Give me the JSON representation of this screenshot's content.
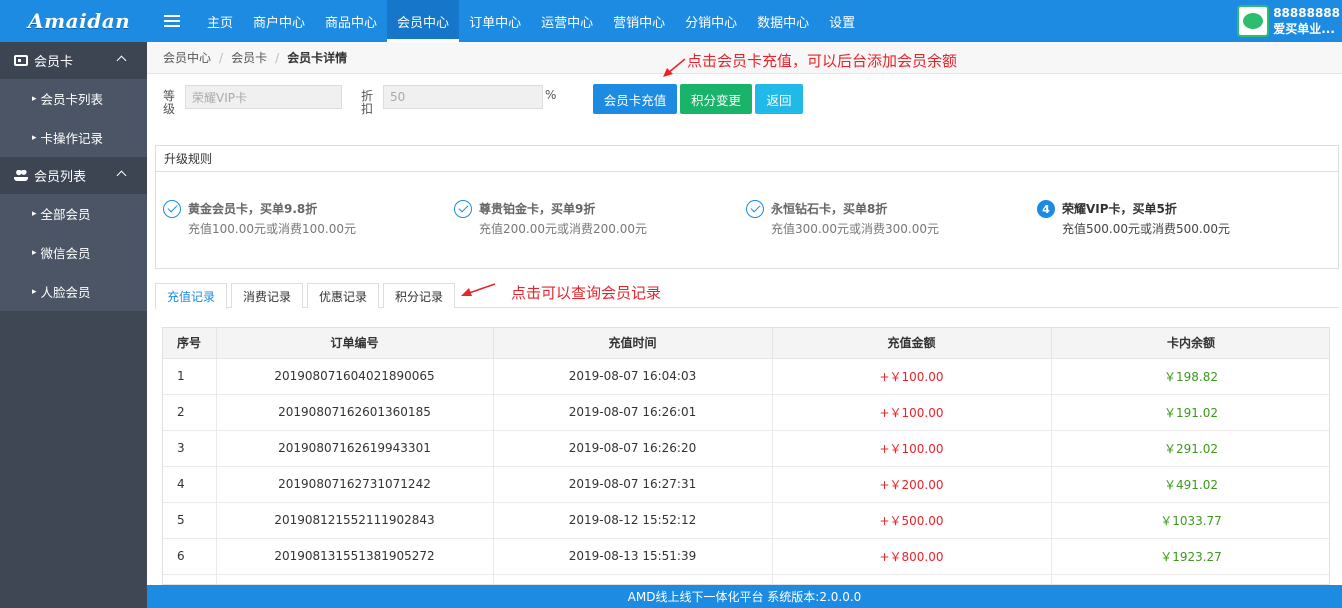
{
  "brand": {
    "logo_text": "Amaidan"
  },
  "nav": {
    "items": [
      "主页",
      "商户中心",
      "商品中心",
      "会员中心",
      "订单中心",
      "运营中心",
      "营销中心",
      "分销中心",
      "数据中心",
      "设置"
    ],
    "active_index": 3
  },
  "user": {
    "id": "88888888",
    "name": "爱买单业..."
  },
  "sidebar": {
    "groups": [
      {
        "label": "会员卡",
        "icon": "card-icon",
        "items": [
          "会员卡列表",
          "卡操作记录"
        ]
      },
      {
        "label": "会员列表",
        "icon": "users-icon",
        "items": [
          "全部会员",
          "微信会员",
          "人脸会员"
        ]
      }
    ]
  },
  "breadcrumb": [
    "会员中心",
    "会员卡",
    "会员卡详情"
  ],
  "form": {
    "level_label": "等级",
    "level_value": "荣耀VIP卡",
    "discount_label": "折扣",
    "discount_value": "50",
    "discount_unit": "%"
  },
  "buttons": {
    "recharge": "会员卡充值",
    "points_change": "积分变更",
    "back": "返回"
  },
  "annotations": {
    "recharge_hint": "点击会员卡充值，可以后台添加会员余额",
    "tabs_hint": "点击可以查询会员记录"
  },
  "rules": {
    "title": "升级规则",
    "steps": [
      {
        "title": "黄金会员卡，买单9.8折",
        "desc": "充值100.00元或消费100.00元",
        "done": true
      },
      {
        "title": "尊贵铂金卡，买单9折",
        "desc": "充值200.00元或消费200.00元",
        "done": true
      },
      {
        "title": "永恒钻石卡，买单8折",
        "desc": "充值300.00元或消费300.00元",
        "done": true
      },
      {
        "title": "荣耀VIP卡，买单5折",
        "desc": "充值500.00元或消费500.00元",
        "done": false,
        "number": "4"
      }
    ]
  },
  "tabs": {
    "items": [
      "充值记录",
      "消费记录",
      "优惠记录",
      "积分记录"
    ],
    "active_index": 0
  },
  "table": {
    "columns": [
      "序号",
      "订单编号",
      "充值时间",
      "充值金额",
      "卡内余额"
    ],
    "rows": [
      [
        "1",
        "20190807160402189006​5",
        "2019-08-07 16:04:03",
        "+￥100.00",
        "￥198.82"
      ],
      [
        "2",
        "20190807162601360185",
        "2019-08-07 16:26:01",
        "+￥100.00",
        "￥191.02"
      ],
      [
        "3",
        "20190807162619943301",
        "2019-08-07 16:26:20",
        "+￥100.00",
        "￥291.02"
      ],
      [
        "4",
        "20190807162731071242",
        "2019-08-07 16:27:31",
        "+￥200.00",
        "￥491.02"
      ],
      [
        "5",
        "20190812155211190284​3",
        "2019-08-12 15:52:12",
        "+￥500.00",
        "￥1033.77"
      ],
      [
        "6",
        "20190813155138190527​2",
        "2019-08-13 15:51:39",
        "+￥800.00",
        "￥1923.27"
      ]
    ]
  },
  "footer": {
    "text": "AMD线上线下一体化平台 系统版本:2.0.0.0"
  },
  "colors": {
    "primary": "#1e8be3",
    "green": "#1ab36a",
    "cyan": "#20b9e8",
    "red": "#e8242a",
    "balance": "#3c9a1c",
    "sidebar": "#4c5565"
  }
}
